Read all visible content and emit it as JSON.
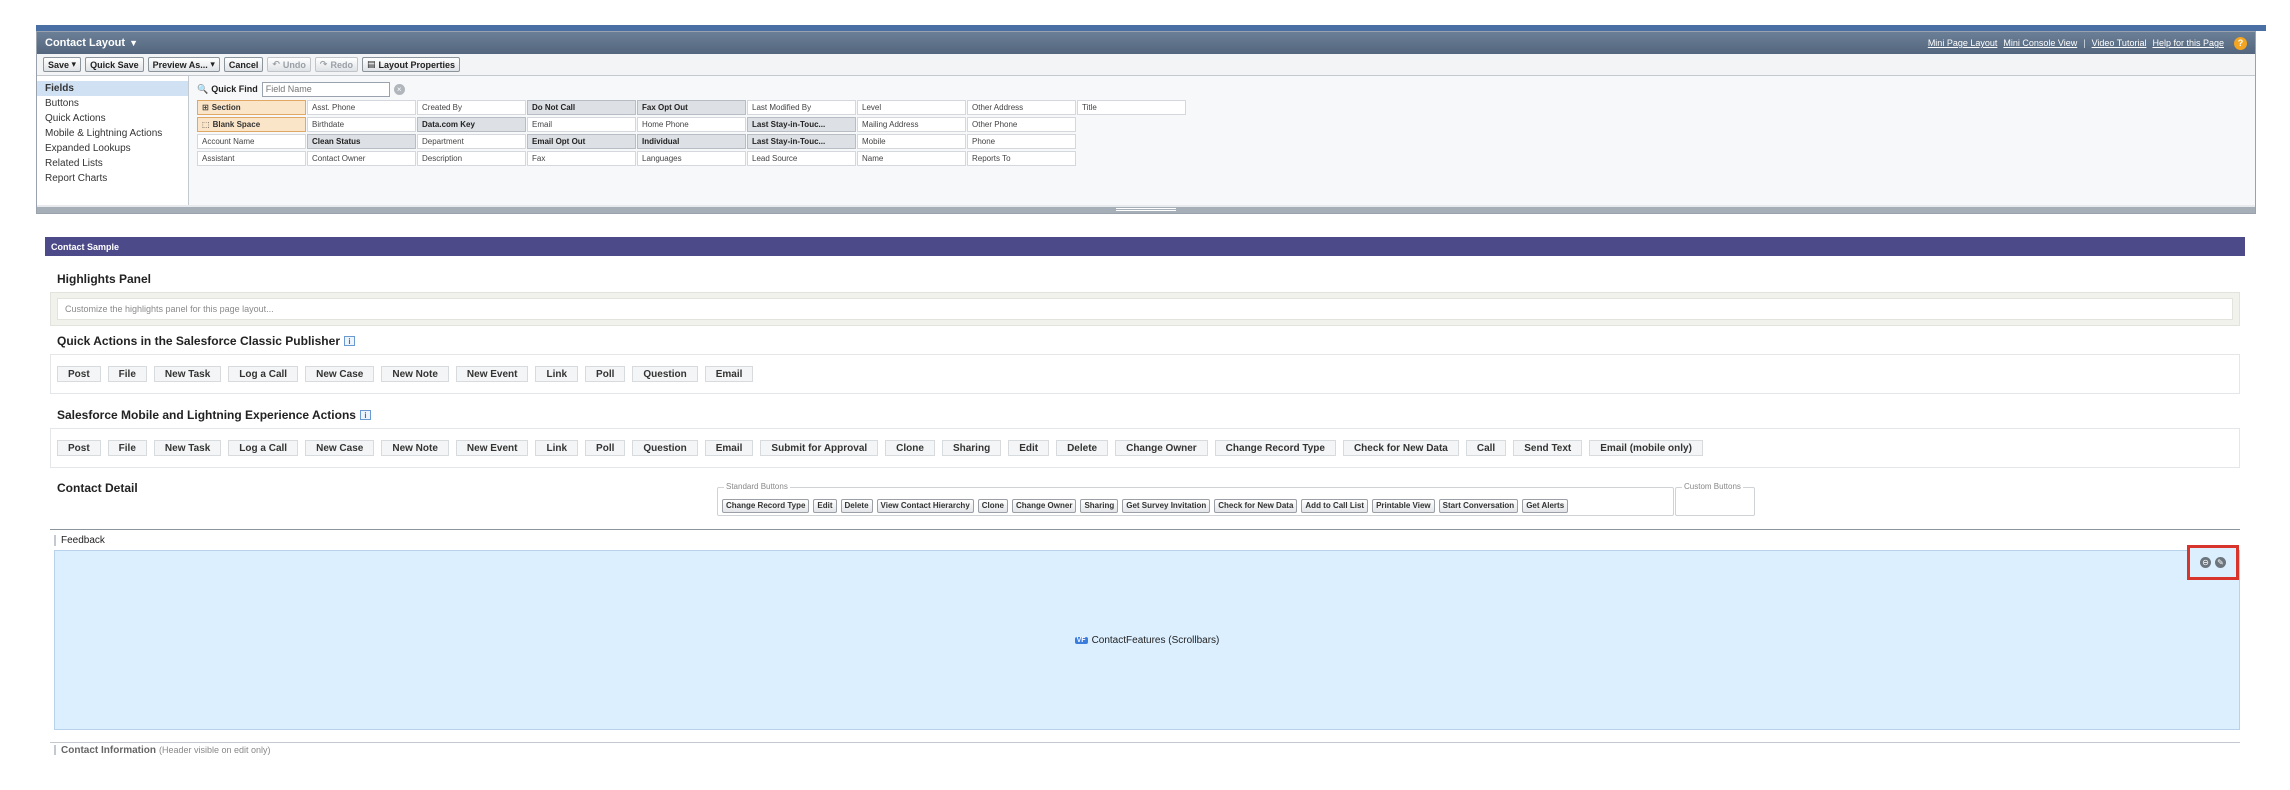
{
  "title_bar": {
    "title": "Contact Layout",
    "links": [
      "Mini Page Layout",
      "Mini Console View",
      "Video Tutorial",
      "Help for this Page"
    ]
  },
  "toolbar": {
    "save": "Save",
    "quick_save": "Quick Save",
    "preview_as": "Preview As...",
    "cancel": "Cancel",
    "undo": "Undo",
    "redo": "Redo",
    "layout_properties": "Layout Properties"
  },
  "categories": [
    "Fields",
    "Buttons",
    "Quick Actions",
    "Mobile & Lightning Actions",
    "Expanded Lookups",
    "Related Lists",
    "Report Charts"
  ],
  "quick_find": {
    "label": "Quick Find",
    "placeholder": "Field Name"
  },
  "field_rows": [
    [
      {
        "label": "Section",
        "style": "special"
      },
      {
        "label": "Asst. Phone",
        "style": "normal"
      },
      {
        "label": "Created By",
        "style": "normal"
      },
      {
        "label": "Do Not Call",
        "style": "used"
      },
      {
        "label": "Fax Opt Out",
        "style": "used"
      },
      {
        "label": "Last Modified By",
        "style": "normal"
      },
      {
        "label": "Level",
        "style": "normal"
      },
      {
        "label": "Other Address",
        "style": "normal"
      },
      {
        "label": "Title",
        "style": "normal"
      }
    ],
    [
      {
        "label": "Blank Space",
        "style": "special"
      },
      {
        "label": "Birthdate",
        "style": "normal"
      },
      {
        "label": "Data.com Key",
        "style": "used"
      },
      {
        "label": "Email",
        "style": "normal"
      },
      {
        "label": "Home Phone",
        "style": "normal"
      },
      {
        "label": "Last Stay-in-Touc...",
        "style": "used"
      },
      {
        "label": "Mailing Address",
        "style": "normal"
      },
      {
        "label": "Other Phone",
        "style": "normal"
      },
      {
        "label": "",
        "style": "empty"
      }
    ],
    [
      {
        "label": "Account Name",
        "style": "normal"
      },
      {
        "label": "Clean Status",
        "style": "used"
      },
      {
        "label": "Department",
        "style": "normal"
      },
      {
        "label": "Email Opt Out",
        "style": "used"
      },
      {
        "label": "Individual",
        "style": "used"
      },
      {
        "label": "Last Stay-in-Touc...",
        "style": "used"
      },
      {
        "label": "Mobile",
        "style": "normal"
      },
      {
        "label": "Phone",
        "style": "normal"
      },
      {
        "label": "",
        "style": "empty"
      }
    ],
    [
      {
        "label": "Assistant",
        "style": "normal"
      },
      {
        "label": "Contact Owner",
        "style": "normal"
      },
      {
        "label": "Description",
        "style": "normal"
      },
      {
        "label": "Fax",
        "style": "normal"
      },
      {
        "label": "Languages",
        "style": "normal"
      },
      {
        "label": "Lead Source",
        "style": "normal"
      },
      {
        "label": "Name",
        "style": "normal"
      },
      {
        "label": "Reports To",
        "style": "normal"
      },
      {
        "label": "",
        "style": "empty"
      }
    ]
  ],
  "sample_header": "Contact Sample",
  "highlights": {
    "heading": "Highlights Panel",
    "placeholder": "Customize the highlights panel for this page layout..."
  },
  "quick_actions": {
    "heading": "Quick Actions in the Salesforce Classic Publisher",
    "buttons": [
      "Post",
      "File",
      "New Task",
      "Log a Call",
      "New Case",
      "New Note",
      "New Event",
      "Link",
      "Poll",
      "Question",
      "Email"
    ]
  },
  "mobile_actions": {
    "heading": "Salesforce Mobile and Lightning Experience Actions",
    "buttons": [
      "Post",
      "File",
      "New Task",
      "Log a Call",
      "New Case",
      "New Note",
      "New Event",
      "Link",
      "Poll",
      "Question",
      "Email",
      "Submit for Approval",
      "Clone",
      "Sharing",
      "Edit",
      "Delete",
      "Change Owner",
      "Change Record Type",
      "Check for New Data",
      "Call",
      "Send Text",
      "Email (mobile only)"
    ]
  },
  "contact_detail": {
    "heading": "Contact Detail",
    "standard_legend": "Standard Buttons",
    "custom_legend": "Custom Buttons",
    "standard_buttons": [
      "Change Record Type",
      "Edit",
      "Delete",
      "View Contact Hierarchy",
      "Clone",
      "Change Owner",
      "Sharing",
      "Get Survey Invitation",
      "Check for New Data",
      "Add to Call List",
      "Printable View",
      "Start Conversation",
      "Get Alerts"
    ]
  },
  "feedback": {
    "label": "Feedback",
    "vf_badge": "VF",
    "vf_label": "ContactFeatures (Scrollbars)"
  },
  "contact_information": {
    "label": "Contact Information",
    "note": "(Header visible on edit only)"
  }
}
